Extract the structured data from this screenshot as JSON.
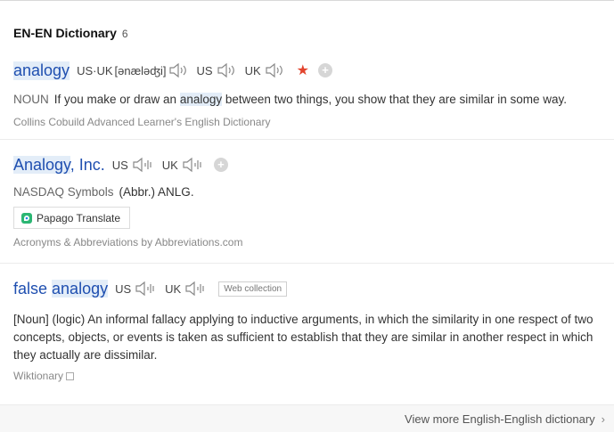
{
  "header": {
    "title": "EN-EN Dictionary",
    "count": "6"
  },
  "entry1": {
    "word": "analogy",
    "pron_label": "US·UK",
    "ipa": "[ənæləʤi]",
    "us_label": "US",
    "uk_label": "UK",
    "pos": "NOUN",
    "def_before": "If you make or draw an ",
    "def_hl": "analogy",
    "def_after": " between two things, you show that they are similar in some way.",
    "source": "Collins Cobuild Advanced Learner's English Dictionary"
  },
  "entry2": {
    "word_hl": "Analogy",
    "word_rest": ", Inc.",
    "us_label": "US",
    "uk_label": "UK",
    "symbols": "NASDAQ Symbols",
    "abbr": "(Abbr.) ANLG.",
    "papago": "Papago Translate",
    "source": "Acronyms & Abbreviations by Abbreviations.com"
  },
  "entry3": {
    "word_pre": "false ",
    "word_hl": "analogy",
    "us_label": "US",
    "uk_label": "UK",
    "tag": "Web collection",
    "definition": "[Noun] (logic) An informal fallacy applying to inductive arguments, in which the similarity in one respect of two concepts, objects, or events is taken as sufficient to establish that they are similar in another respect in which they actually are dissimilar.",
    "source": "Wiktionary"
  },
  "footer": {
    "more": "View more English-English dictionary"
  },
  "colors": {
    "link": "#1f4fb0",
    "highlight": "#e3edf8",
    "star": "#e2442e"
  }
}
